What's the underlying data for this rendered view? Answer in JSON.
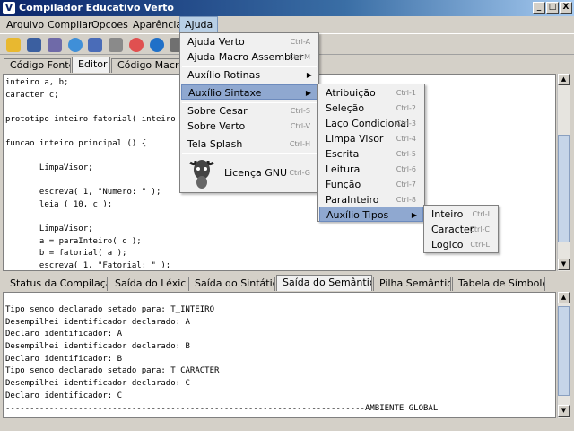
{
  "window": {
    "title": "Compilador Educativo Verto",
    "logo_letter": "V",
    "minimize": "_",
    "maximize": "□",
    "close": "X"
  },
  "menubar": [
    "Arquivo",
    "Compilar",
    "Opcoes",
    "Aparência",
    "Ajuda"
  ],
  "toolbar_icons": [
    "open-folder-icon",
    "save-icon",
    "save-all-icon",
    "refresh-icon",
    "build-icon",
    "tools-icon",
    "help-ring-icon",
    "info-icon",
    "gnu-icon"
  ],
  "editor_tabs": [
    "Código Fonte",
    "Editor",
    "Código MacroA"
  ],
  "editor_lines": [
    "inteiro a, b;",
    "caracter c;",
    "",
    "prototipo inteiro fatorial( inteiro",
    "",
    "funcao inteiro principal () {",
    "",
    "       LimpaVisor;",
    "",
    "       escreva( 1, \"Numero: \" );",
    "       leia ( 10, c );",
    "",
    "       LimpaVisor;",
    "       a = paraInteiro( c );",
    "       b = fatorial( a );",
    "       escreva( 1, \"Fatorial: \" );"
  ],
  "output_tabs": [
    "Status da Compilação",
    "Saída do Léxico",
    "Saída do Sintático",
    "Saída do Semântico",
    "Pilha Semântica",
    "Tabela de Símbolos"
  ],
  "output_lines": [
    "Tipo sendo declarado setado para: T_INTEIRO",
    "Desempilhei identificador declarado: A",
    "Declaro identificador: A",
    "Desempilhei identificador declarado: B",
    "Declaro identificador: B",
    "Tipo sendo declarado setado para: T_CARACTER",
    "Desempilhei identificador declarado: C",
    "Declaro identificador: C",
    "--------------------------------------------------------------------------AMBIENTE GLOBAL"
  ],
  "ajuda_menu": [
    {
      "label": "Ajuda Verto",
      "shortcut": "Ctrl-A"
    },
    {
      "label": "Ajuda Macro Assembler",
      "shortcut": "Ctrl-M"
    },
    {
      "label": "Auxílio Rotinas",
      "submenu": true
    },
    {
      "label": "Auxílio Sintaxe",
      "submenu": true
    },
    {
      "label": "Sobre Cesar",
      "shortcut": "Ctrl-S"
    },
    {
      "label": "Sobre Verto",
      "shortcut": "Ctrl-V"
    },
    {
      "label": "Tela Splash",
      "shortcut": "Ctrl-H"
    },
    {
      "label": "Licença GNU",
      "shortcut": "Ctrl-G"
    }
  ],
  "sintaxe_menu": [
    {
      "label": "Atribuição",
      "shortcut": "Ctrl-1"
    },
    {
      "label": "Seleção",
      "shortcut": "Ctrl-2"
    },
    {
      "label": "Laço Condicional",
      "shortcut": "Ctrl-3"
    },
    {
      "label": "Limpa Visor",
      "shortcut": "Ctrl-4"
    },
    {
      "label": "Escrita",
      "shortcut": "Ctrl-5"
    },
    {
      "label": "Leitura",
      "shortcut": "Ctrl-6"
    },
    {
      "label": "Função",
      "shortcut": "Ctrl-7"
    },
    {
      "label": "ParaInteiro",
      "shortcut": "Ctrl-8"
    },
    {
      "label": "Auxílio Tipos",
      "submenu": true
    }
  ],
  "tipos_menu": [
    {
      "label": "Inteiro",
      "shortcut": "Ctrl-I"
    },
    {
      "label": "Caracter",
      "shortcut": "Ctrl-C"
    },
    {
      "label": "Logico",
      "shortcut": "Ctrl-L"
    }
  ],
  "colors": {
    "title_bar": "#0a246a",
    "menu_highlight": "#8fa8d0",
    "editor_bg": "#ffffff"
  }
}
